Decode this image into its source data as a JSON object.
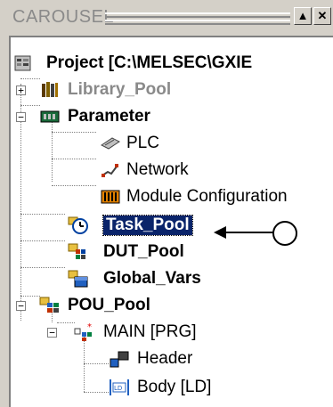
{
  "window": {
    "title": "CAROUSEL",
    "minimize_glyph": "▲",
    "close_glyph": "✕"
  },
  "tree": {
    "root": {
      "label": "Project [C:\\MELSEC\\GXIE",
      "icon": "project-icon"
    },
    "items": [
      {
        "label": "Library_Pool",
        "icon": "library-books-icon",
        "expander": "+"
      },
      {
        "label": "Parameter",
        "icon": "parameter-chip-icon",
        "expander": "−"
      },
      {
        "label": "PLC",
        "icon": "plc-module-icon"
      },
      {
        "label": "Network",
        "icon": "network-icon"
      },
      {
        "label": "Module Configuration",
        "icon": "module-configuration-icon"
      },
      {
        "label": "Task_Pool",
        "icon": "task-clock-icon",
        "selected": true
      },
      {
        "label": "DUT_Pool",
        "icon": "dut-icon"
      },
      {
        "label": "Global_Vars",
        "icon": "global-vars-icon"
      },
      {
        "label": "POU_Pool",
        "icon": "pou-pool-icon",
        "expander": "−"
      },
      {
        "label": "MAIN [PRG]",
        "icon": "program-icon",
        "expander": "−"
      },
      {
        "label": "Header",
        "icon": "header-icon"
      },
      {
        "label": "Body [LD]",
        "icon": "ladder-body-icon"
      }
    ]
  },
  "colors": {
    "selection": "#0a246a",
    "disabled_text": "#8a8a8a",
    "window_face": "#d4d0c8"
  }
}
